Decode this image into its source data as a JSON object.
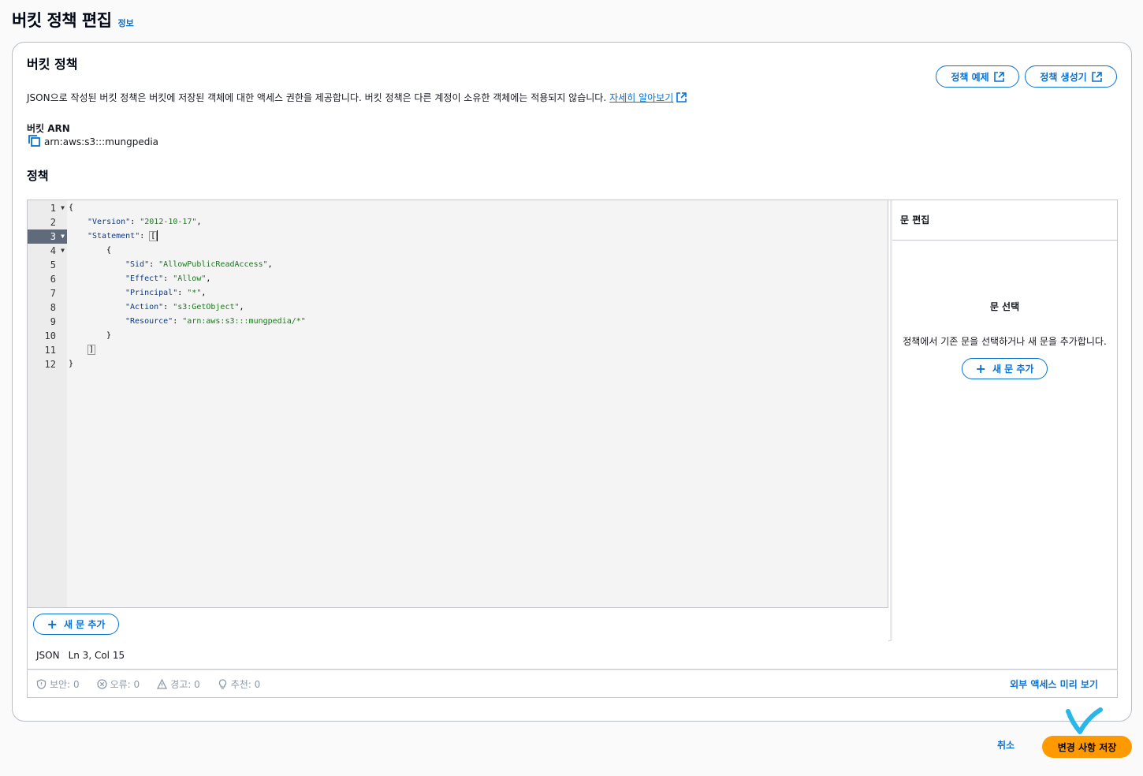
{
  "page": {
    "title": "버킷 정책 편집",
    "info_link": "정보"
  },
  "card": {
    "title": "버킷 정책",
    "examples_button": "정책 예제",
    "generator_button": "정책 생성기",
    "description": "JSON으로 작성된 버킷 정책은 버킷에 저장된 객체에 대한 액세스 권한을 제공합니다. 버킷 정책은 다른 계정이 소유한 객체에는 적용되지 않습니다.",
    "learn_more": "자세히 알아보기",
    "arn_label": "버킷 ARN",
    "arn_value": "arn:aws:s3:::mungpedia",
    "policy_label": "정책"
  },
  "editor": {
    "line_numbers": [
      "1",
      "2",
      "3",
      "4",
      "5",
      "6",
      "7",
      "8",
      "9",
      "10",
      "11",
      "12"
    ],
    "active_line": 3,
    "fold_lines": [
      1,
      3,
      4
    ],
    "code": {
      "l1": "{",
      "l2_key": "\"Version\"",
      "l2_val": "\"2012-10-17\"",
      "l3_key": "\"Statement\"",
      "l3_val": "[",
      "l4": "{",
      "l5_key": "\"Sid\"",
      "l5_val": "\"AllowPublicReadAccess\"",
      "l6_key": "\"Effect\"",
      "l6_val": "\"Allow\"",
      "l7_key": "\"Principal\"",
      "l7_val": "\"*\"",
      "l8_key": "\"Action\"",
      "l8_val": "\"s3:GetObject\"",
      "l9_key": "\"Resource\"",
      "l9_val": "\"arn:aws:s3:::mungpedia/*\"",
      "l10": "}",
      "l11": "]",
      "l12": "}"
    },
    "add_statement": "새 문 추가"
  },
  "side_panel": {
    "title": "문 편집",
    "select_title": "문 선택",
    "select_desc": "정책에서 기존 문을 선택하거나 새 문을 추가합니다.",
    "add_statement": "새 문 추가"
  },
  "status": {
    "mode": "JSON",
    "position": "Ln 3, Col 15"
  },
  "issues": {
    "security": "보안: 0",
    "errors": "오류: 0",
    "warnings": "경고: 0",
    "suggestions": "추천: 0",
    "preview_link": "외부 액세스 미리 보기"
  },
  "footer": {
    "cancel": "취소",
    "save": "변경 사항 저장"
  },
  "colors": {
    "link_blue": "#0972d3",
    "primary_orange": "#ff9900",
    "checkmark_cyan": "#29b6e8"
  }
}
